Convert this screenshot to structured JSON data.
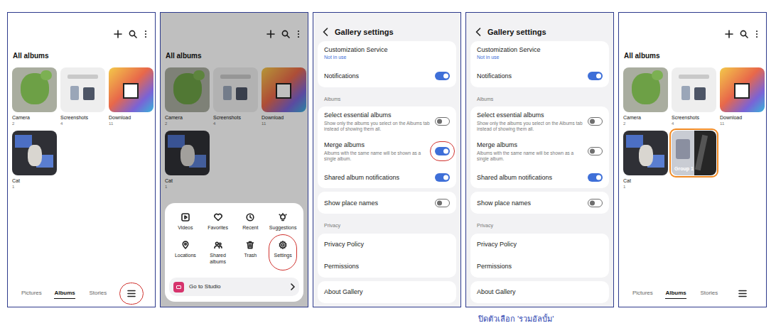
{
  "screens": [
    {
      "kind": "albums",
      "dimmed": false,
      "title": "All albums",
      "albums": [
        {
          "kind": "album",
          "name": "Camera",
          "count": "2",
          "highlighted": false
        },
        {
          "kind": "album",
          "name": "Screenshots",
          "count": "4",
          "highlighted": false
        },
        {
          "kind": "album",
          "name": "Download",
          "count": "11",
          "highlighted": false
        },
        {
          "kind": "album",
          "name": "Cat",
          "count": "1",
          "highlighted": false
        }
      ],
      "tabs": [
        {
          "label": "Pictures",
          "selected": false
        },
        {
          "label": "Albums",
          "selected": true
        },
        {
          "label": "Stories",
          "selected": false
        }
      ],
      "menu_button": {
        "circled": true
      }
    },
    {
      "kind": "albums",
      "dimmed": true,
      "title": "All albums",
      "albums": [
        {
          "kind": "album",
          "name": "Camera",
          "count": "2",
          "highlighted": false
        },
        {
          "kind": "album",
          "name": "Screenshots",
          "count": "4",
          "highlighted": false
        },
        {
          "kind": "album",
          "name": "Download",
          "count": "11",
          "highlighted": false
        },
        {
          "kind": "album",
          "name": "Cat",
          "count": "1",
          "highlighted": false
        }
      ],
      "sheet": {
        "items": [
          {
            "label": "Videos",
            "circled": false
          },
          {
            "label": "Favorites",
            "circled": false
          },
          {
            "label": "Recent",
            "circled": false
          },
          {
            "label": "Suggestions",
            "circled": false
          },
          {
            "label": "Locations",
            "circled": false
          },
          {
            "label": "Shared albums",
            "circled": false
          },
          {
            "label": "Trash",
            "circled": false
          },
          {
            "label": "Settings",
            "circled": true
          }
        ],
        "studio": "Go to Studio"
      }
    },
    {
      "kind": "settings",
      "title": "Gallery settings",
      "groups": [
        {
          "kind": "card",
          "rows": [
            {
              "kind": "link",
              "title": "Customization Service",
              "subtitle": "Not in use"
            },
            {
              "kind": "toggle",
              "title": "Notifications",
              "on": true,
              "circled": false
            }
          ]
        },
        {
          "kind": "section",
          "label": "Albums"
        },
        {
          "kind": "card",
          "rows": [
            {
              "kind": "toggle",
              "title": "Select essential albums",
              "description": "Show only the albums you select on the Albums tab instead of showing them all.",
              "on": false,
              "circled": false
            },
            {
              "kind": "toggle",
              "title": "Merge albums",
              "description": "Albums with the same name will be shown as a single album.",
              "on": true,
              "circled": true
            },
            {
              "kind": "toggle",
              "title": "Shared album notifications",
              "on": true,
              "circled": false
            }
          ]
        },
        {
          "kind": "card",
          "rows": [
            {
              "kind": "toggle",
              "title": "Show place names",
              "on": false,
              "circled": false
            }
          ]
        },
        {
          "kind": "section",
          "label": "Privacy"
        },
        {
          "kind": "card",
          "rows": [
            {
              "kind": "link",
              "title": "Privacy Policy"
            },
            {
              "kind": "link",
              "title": "Permissions"
            }
          ]
        },
        {
          "kind": "card",
          "rows": [
            {
              "kind": "link",
              "title": "About Gallery"
            }
          ]
        }
      ]
    },
    {
      "kind": "settings",
      "title": "Gallery settings",
      "caption": "ปิดตัวเลือก 'รวมอัลบั้ม'",
      "groups": [
        {
          "kind": "card",
          "rows": [
            {
              "kind": "link",
              "title": "Customization Service",
              "subtitle": "Not in use"
            },
            {
              "kind": "toggle",
              "title": "Notifications",
              "on": true,
              "circled": false
            }
          ]
        },
        {
          "kind": "section",
          "label": "Albums"
        },
        {
          "kind": "card",
          "rows": [
            {
              "kind": "toggle",
              "title": "Select essential albums",
              "description": "Show only the albums you select on the Albums tab instead of showing them all.",
              "on": false,
              "circled": false
            },
            {
              "kind": "toggle",
              "title": "Merge albums",
              "description": "Albums with the same name will be shown as a single album.",
              "on": false,
              "circled": false
            },
            {
              "kind": "toggle",
              "title": "Shared album notifications",
              "on": true,
              "circled": false
            }
          ]
        },
        {
          "kind": "card",
          "rows": [
            {
              "kind": "toggle",
              "title": "Show place names",
              "on": false,
              "circled": false
            }
          ]
        },
        {
          "kind": "section",
          "label": "Privacy"
        },
        {
          "kind": "card",
          "rows": [
            {
              "kind": "link",
              "title": "Privacy Policy"
            },
            {
              "kind": "link",
              "title": "Permissions"
            }
          ]
        },
        {
          "kind": "card",
          "rows": [
            {
              "kind": "link",
              "title": "About Gallery"
            }
          ]
        }
      ]
    },
    {
      "kind": "albums",
      "dimmed": false,
      "title": "All albums",
      "albums": [
        {
          "kind": "album",
          "name": "Camera",
          "count": "2",
          "highlighted": false
        },
        {
          "kind": "album",
          "name": "Screenshots",
          "count": "4",
          "highlighted": false
        },
        {
          "kind": "album",
          "name": "Download",
          "count": "11",
          "highlighted": false
        },
        {
          "kind": "album",
          "name": "Cat",
          "count": "1",
          "highlighted": false
        },
        {
          "kind": "group",
          "name": "Group 1",
          "highlighted": true
        }
      ],
      "tabs": [
        {
          "label": "Pictures",
          "selected": false
        },
        {
          "label": "Albums",
          "selected": true
        },
        {
          "label": "Stories",
          "selected": false
        }
      ],
      "menu_button": {
        "circled": false
      }
    }
  ]
}
